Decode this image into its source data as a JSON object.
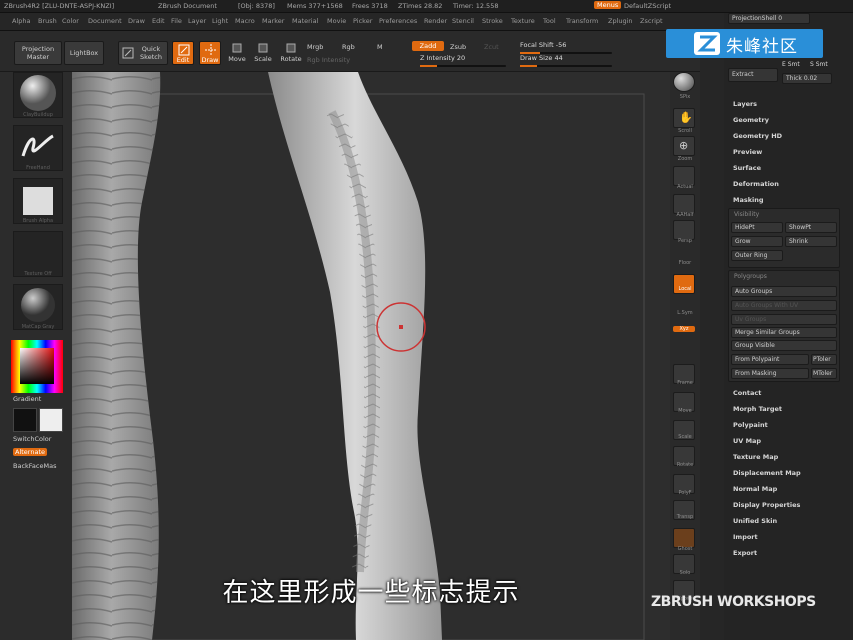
{
  "titlebar": {
    "app": "ZBrush4R2 [ZLU-DNTE-ASPJ-KNZI]",
    "doc": "ZBrush Document",
    "obj": "[Obj: 8378]",
    "mem": "Mems 377+1568",
    "free": "Frees 3718",
    "ztime": "ZTimes 28.82",
    "timer": "Timer: 12.558",
    "menus_btn": "Menus",
    "script": "DefaultZScript"
  },
  "menus": [
    "Alpha",
    "Brush",
    "Color",
    "Document",
    "Draw",
    "Edit",
    "File",
    "Layer",
    "Light",
    "Macro",
    "Marker",
    "Material",
    "Movie",
    "Picker",
    "Preferences",
    "Render",
    "Stencil",
    "Stroke",
    "Texture",
    "Tool",
    "Transform",
    "Zplugin",
    "Zscript"
  ],
  "shelf": {
    "projection_master": "Projection Master",
    "lightbox": "LightBox",
    "quick_sketch": "Quick Sketch",
    "edit": "Edit",
    "draw": "Draw",
    "move": "Move",
    "scale": "Scale",
    "rotate": "Rotate",
    "mrgb": "Mrgb",
    "rgb": "Rgb",
    "m": "M",
    "rgb_intensity": "Rgb Intensity",
    "zadd": "Zadd",
    "zsub": "Zsub",
    "zcut": "Zcut",
    "z_intensity_label": "Z Intensity",
    "z_intensity": 20,
    "focal_label": "Focal Shift",
    "focal_shift": -56,
    "draw_size_label": "Draw Size",
    "draw_size": 44
  },
  "left": {
    "tiles": [
      "ClayBuildup",
      "FreeHand",
      "Brush Alpha",
      "Texture Off",
      "MatCap Gray"
    ],
    "gradient": "Gradient",
    "switch_color": "SwitchColor",
    "alternate": "Alternate",
    "backface": "BackFaceMas"
  },
  "right_toolbar": [
    "SPix",
    "Scroll",
    "Zoom",
    "Actual",
    "AAHalf",
    "Persp",
    "Floor",
    "Local",
    "L.Sym",
    "Xyz",
    "Frame",
    "Move",
    "Scale",
    "Rotate",
    "PolyF",
    "Transp",
    "Ghost",
    "Solo",
    "Xpose"
  ],
  "panel": {
    "projection_shell_label": "ProjectionShell",
    "projection_shell": 0,
    "extract": "Extract",
    "e_smt": "E Smt",
    "s_smt": "S Smt",
    "thick_label": "Thick",
    "thick": "0.02",
    "items_top": [
      "Layers",
      "Geometry",
      "Geometry HD",
      "Preview",
      "Surface",
      "Deformation",
      "Masking"
    ],
    "visibility": {
      "header": "Visibility",
      "hidept": "HidePt",
      "showpt": "ShowPt",
      "grow": "Grow",
      "shrink": "Shrink",
      "outer_ring": "Outer Ring"
    },
    "polygroups": {
      "header": "Polygroups",
      "auto_groups": "Auto Groups",
      "uv_groups": "Auto Groups With UV",
      "uv_groups2": "Uv Groups",
      "merge_similar": "Merge Similar Groups",
      "group_visible": "Group Visible",
      "from_polypaint": "From Polypaint",
      "ptoler": "PToler",
      "from_masking": "From Masking",
      "mtoler": "MToler"
    },
    "items_bottom": [
      "Contact",
      "Morph Target",
      "Polypaint",
      "UV Map",
      "Texture Map",
      "Displacement Map",
      "Normal Map",
      "Display Properties",
      "Unified Skin",
      "Import",
      "Export"
    ]
  },
  "logo_text": "朱峰社区",
  "subtitle": "在这里形成一些标志提示",
  "watermark": "ZBRUSH WORKSHOPS"
}
